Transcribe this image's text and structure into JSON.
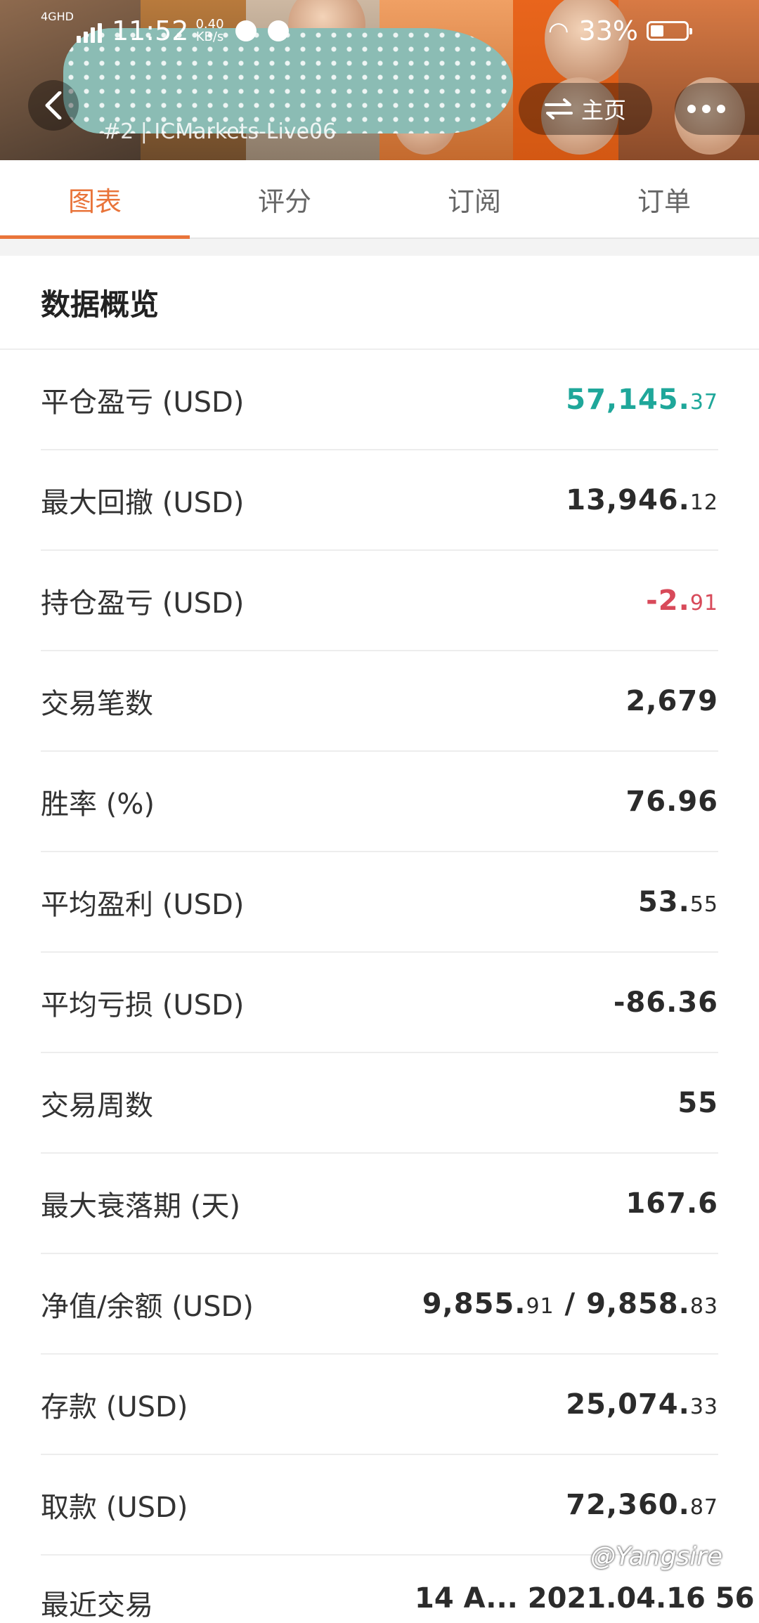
{
  "status_bar": {
    "network": "4GHD",
    "time": "11:52",
    "speed_value": "0.40",
    "speed_unit": "KB/s",
    "battery": "33%"
  },
  "header": {
    "account_label": "#2 | ICMarkets-Live06",
    "home_label": "主页"
  },
  "tabs": [
    {
      "label": "图表",
      "active": true
    },
    {
      "label": "评分",
      "active": false
    },
    {
      "label": "订阅",
      "active": false
    },
    {
      "label": "订单",
      "active": false
    }
  ],
  "section": {
    "title": "数据概览"
  },
  "stats": [
    {
      "label": "平仓盈亏 (USD)",
      "int": "57,145.",
      "dec": "37",
      "tone": "pos"
    },
    {
      "label": "最大回撤 (USD)",
      "int": "13,946.",
      "dec": "12",
      "tone": ""
    },
    {
      "label": "持仓盈亏 (USD)",
      "int": "-2.",
      "dec": "91",
      "tone": "neg"
    },
    {
      "label": "交易笔数",
      "int": "2,679",
      "dec": "",
      "tone": ""
    },
    {
      "label": "胜率 (%)",
      "int": "76.96",
      "dec": "",
      "tone": ""
    },
    {
      "label": "平均盈利 (USD)",
      "int": "53.",
      "dec": "55",
      "tone": ""
    },
    {
      "label": "平均亏损 (USD)",
      "int": "-86.36",
      "dec": "",
      "tone": ""
    },
    {
      "label": "交易周数",
      "int": "55",
      "dec": "",
      "tone": ""
    },
    {
      "label": "最大衰落期 (天)",
      "int": "167.6",
      "dec": "",
      "tone": ""
    },
    {
      "label": "净值/余额 (USD)",
      "int": "9,855.",
      "dec": "91",
      "int2": " / 9,858.",
      "dec2": "83",
      "tone": ""
    },
    {
      "label": "存款 (USD)",
      "int": "25,074.",
      "dec": "33",
      "tone": ""
    },
    {
      "label": "取款 (USD)",
      "int": "72,360.",
      "dec": "87",
      "tone": ""
    }
  ],
  "partial_row": {
    "label": "最近交易",
    "value": "14 A...  2021.04.16 56"
  },
  "watermark": "@Yangsire",
  "colors": {
    "accent": "#e9743a",
    "positive": "#1fa79a",
    "negative": "#d84a5a"
  }
}
